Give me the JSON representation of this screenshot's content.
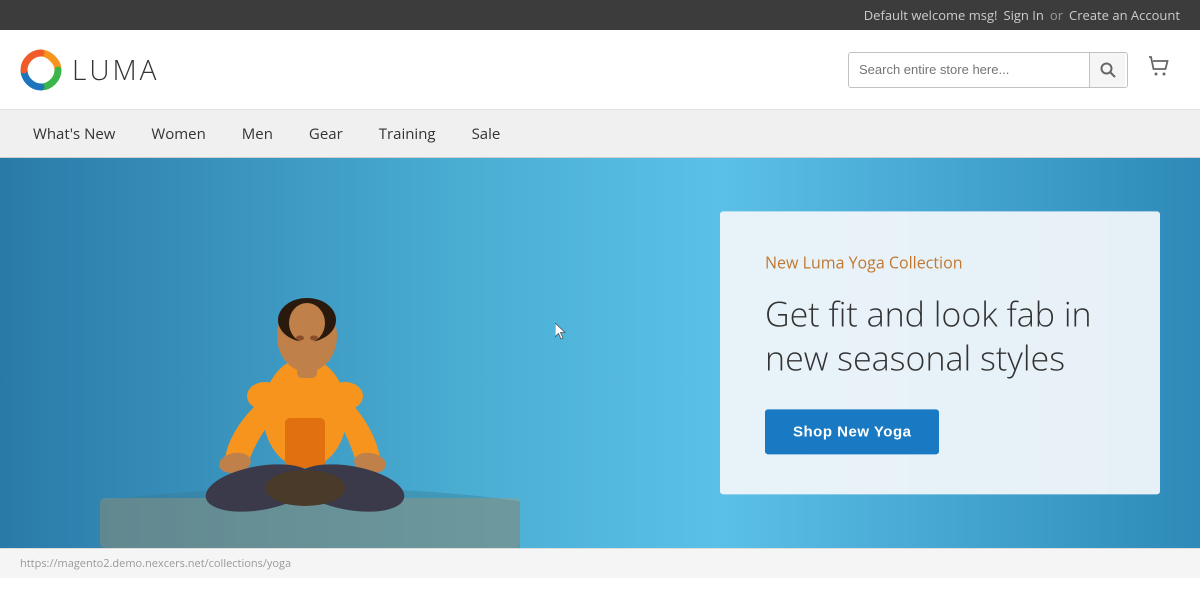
{
  "topbar": {
    "welcome": "Default welcome msg!",
    "signin_label": "Sign In",
    "or_text": "or",
    "create_account_label": "Create an Account"
  },
  "header": {
    "logo_text": "LUMA",
    "search_placeholder": "Search entire store here...",
    "cart_icon": "🛒"
  },
  "nav": {
    "items": [
      {
        "label": "What's New",
        "id": "whats-new"
      },
      {
        "label": "Women",
        "id": "women"
      },
      {
        "label": "Men",
        "id": "men"
      },
      {
        "label": "Gear",
        "id": "gear"
      },
      {
        "label": "Training",
        "id": "training"
      },
      {
        "label": "Sale",
        "id": "sale"
      }
    ]
  },
  "hero": {
    "subtitle": "New Luma Yoga Collection",
    "title": "Get fit and look fab in new seasonal styles",
    "cta_label": "Shop New Yoga"
  },
  "footer": {
    "url_text": "https://magento2.demo.nexcers.net/collections/yoga"
  }
}
